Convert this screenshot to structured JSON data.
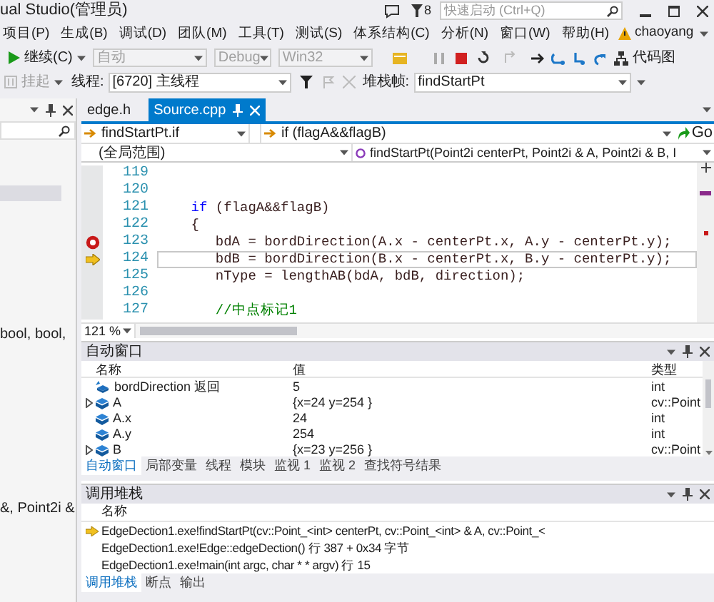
{
  "title_bar": {
    "title": "ual Studio(管理员)",
    "notification_count": "8",
    "quick_launch": {
      "placeholder": "快速启动 (Ctrl+Q)"
    }
  },
  "menu": [
    {
      "label": "项目(P)"
    },
    {
      "label": "生成(B)"
    },
    {
      "label": "调试(D)"
    },
    {
      "label": "团队(M)"
    },
    {
      "label": "工具(T)"
    },
    {
      "label": "测试(S)"
    },
    {
      "label": "体系结构(C)"
    },
    {
      "label": "分析(N)"
    },
    {
      "label": "窗口(W)"
    },
    {
      "label": "帮助(H)"
    }
  ],
  "user": {
    "name": "chaoyang"
  },
  "debug_toolbar": {
    "continue": "继续(C)",
    "dropdowns": [
      {
        "value": "自动",
        "disabled": true
      },
      {
        "value": "Debug",
        "disabled": true
      },
      {
        "value": "Win32",
        "disabled": true
      }
    ],
    "code_map": "代码图"
  },
  "thread_toolbar": {
    "suspend": "挂起",
    "thread_label": "线程:",
    "thread": "[6720] 主线程",
    "frame_label": "堆栈帧:",
    "frame": "findStartPt"
  },
  "side_panel": {
    "texts": [
      "bool, bool,",
      "&, Point2i &"
    ]
  },
  "editor_tabs": [
    {
      "label": "edge.h",
      "selected": false
    },
    {
      "label": "Source.cpp",
      "selected": true
    }
  ],
  "navigation": {
    "scope": "findStartPt.if",
    "block": "if (flagA&&flagB)",
    "go": "Go",
    "context": "(全局范围)",
    "member": "findStartPt(Point2i centerPt, Point2i & A, Point2i & B, I"
  },
  "code_lines": [
    {
      "number": "119",
      "breakpoint": false,
      "current": false
    },
    {
      "number": "120",
      "breakpoint": false,
      "current": false
    },
    {
      "number": "121",
      "breakpoint": false,
      "current": false,
      "tokens": [
        {
          "text": "    if",
          "kind": "keyword"
        },
        {
          "text": " (flagA&&flagB)",
          "kind": "plain"
        }
      ]
    },
    {
      "number": "122",
      "breakpoint": false,
      "current": false,
      "tokens": [
        {
          "text": "    {",
          "kind": "plain"
        }
      ]
    },
    {
      "number": "123",
      "breakpoint": true,
      "current": false,
      "tokens": [
        {
          "text": "       bdA = bordDirection(A.x - centerPt.x, A.y - centerPt.y);",
          "kind": "plain"
        }
      ]
    },
    {
      "number": "124",
      "breakpoint": false,
      "current": true,
      "tokens": [
        {
          "text": "       bdB = bordDirection(B.x - centerPt.x, B.y - centerPt.y);",
          "kind": "plain"
        }
      ]
    },
    {
      "number": "125",
      "breakpoint": false,
      "current": false,
      "tokens": [
        {
          "text": "       nType = lengthAB(bdA, bdB, direction);",
          "kind": "plain"
        }
      ]
    },
    {
      "number": "126",
      "breakpoint": false,
      "current": false
    },
    {
      "number": "127",
      "breakpoint": false,
      "current": false,
      "tokens": [
        {
          "text": "       //中点标记1",
          "kind": "comment"
        }
      ]
    }
  ],
  "zoom": "121 %",
  "autos": {
    "title": "自动窗口",
    "columns": [
      "名称",
      "值",
      "类型"
    ],
    "rows": [
      {
        "name": "bordDirection 返回",
        "value": "5",
        "type": "int",
        "kind": "return",
        "expandable": false
      },
      {
        "name": "A",
        "value": "{x=24 y=254 }",
        "type": "cv::Point",
        "kind": "variable",
        "expandable": true
      },
      {
        "name": "A.x",
        "value": "24",
        "type": "int",
        "kind": "variable",
        "expandable": false
      },
      {
        "name": "A.y",
        "value": "254",
        "type": "int",
        "kind": "variable",
        "expandable": false
      },
      {
        "name": "B",
        "value": "{x=23 y=256 }",
        "type": "cv::Point",
        "kind": "variable",
        "expandable": true
      }
    ],
    "tabs": [
      {
        "label": "自动窗口",
        "selected": true
      },
      {
        "label": "局部变量",
        "selected": false
      },
      {
        "label": "线程",
        "selected": false
      },
      {
        "label": "模块",
        "selected": false
      },
      {
        "label": "监视 1",
        "selected": false
      },
      {
        "label": "监视 2",
        "selected": false
      },
      {
        "label": "查找符号结果",
        "selected": false
      }
    ]
  },
  "call_stack": {
    "title": "调用堆栈",
    "columns": [
      "名称"
    ],
    "rows": [
      {
        "text": "EdgeDection1.exe!findStartPt(cv::Point_<int> centerPt, cv::Point_<int> & A, cv::Point_<",
        "current": true
      },
      {
        "text": "EdgeDection1.exe!Edge::edgeDection() 行 387 + 0x34 字节",
        "current": false
      },
      {
        "text": "EdgeDection1.exe!main(int argc, char * * argv) 行 15",
        "current": false
      }
    ],
    "tabs": [
      {
        "label": "调用堆栈",
        "selected": true
      },
      {
        "label": "断点",
        "selected": false
      },
      {
        "label": "输出",
        "selected": false
      }
    ]
  }
}
